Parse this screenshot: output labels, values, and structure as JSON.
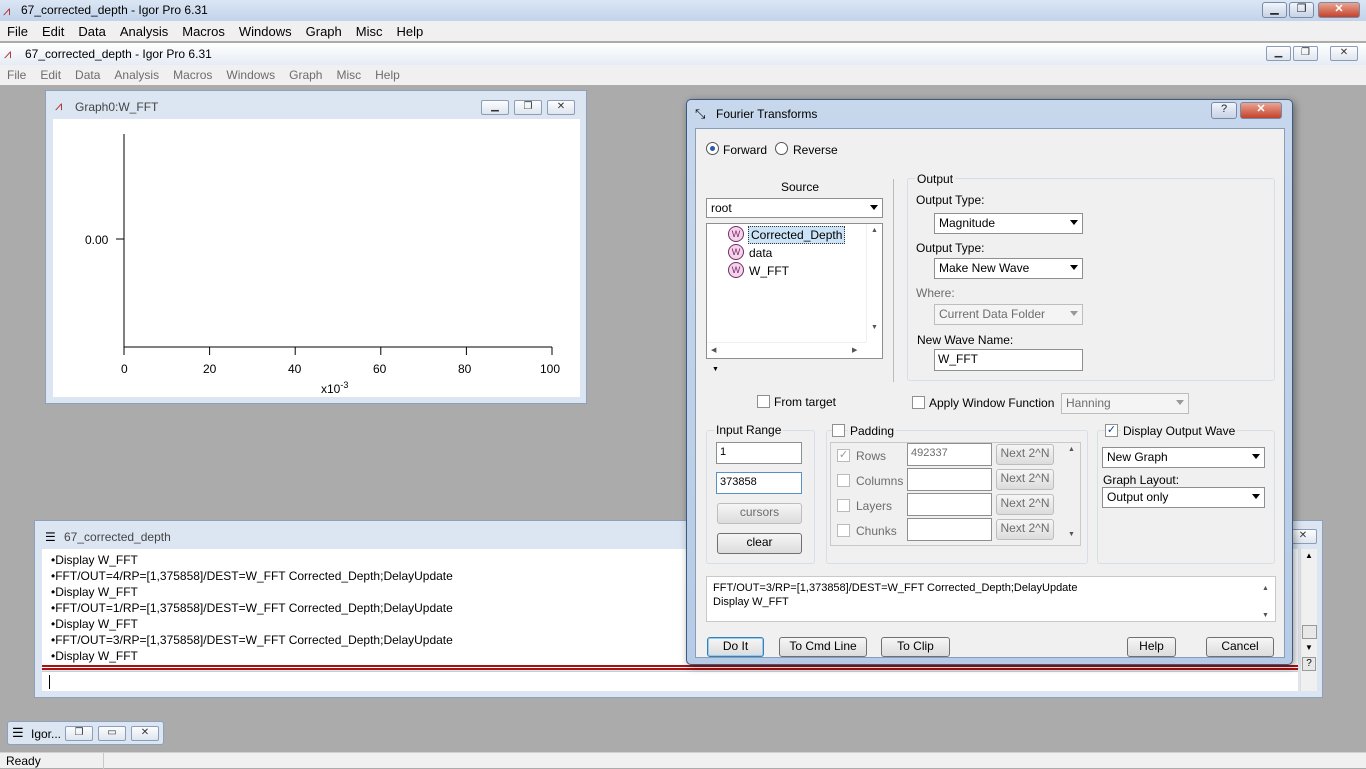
{
  "window_title": "67_corrected_depth - Igor Pro 6.31",
  "menu": [
    "File",
    "Edit",
    "Data",
    "Analysis",
    "Macros",
    "Windows",
    "Graph",
    "Misc",
    "Help"
  ],
  "inner_title": "67_corrected_depth - Igor Pro 6.31",
  "graph": {
    "title": "Graph0:W_FFT",
    "y_tick": "0.00",
    "x_ticks": [
      "0",
      "20",
      "40",
      "60",
      "80",
      "100"
    ],
    "x_multiplier": "x10",
    "x_exponent": "-3"
  },
  "history": {
    "title": "67_corrected_depth",
    "lines": [
      "•Display W_FFT",
      "•FFT/OUT=4/RP=[1,375858]/DEST=W_FFT Corrected_Depth;DelayUpdate",
      "•Display W_FFT",
      "•FFT/OUT=1/RP=[1,375858]/DEST=W_FFT Corrected_Depth;DelayUpdate",
      "•Display W_FFT",
      "•FFT/OUT=3/RP=[1,375858]/DEST=W_FFT Corrected_Depth;DelayUpdate",
      "•Display W_FFT"
    ]
  },
  "taskbar": {
    "minimized_label": "Igor..."
  },
  "status": "Ready",
  "dialog": {
    "title": "Fourier Transforms",
    "forward": "Forward",
    "reverse": "Reverse",
    "source_label": "Source",
    "source_folder": "root",
    "waves": [
      "Corrected_Depth",
      "data",
      "W_FFT"
    ],
    "output_group": "Output",
    "output_type_label_1": "Output Type:",
    "output_type_1": "Magnitude",
    "output_type_label_2": "Output Type:",
    "output_type_2": "Make New Wave",
    "where_label": "Where:",
    "where_value": "Current Data Folder",
    "new_wave_label": "New Wave Name:",
    "new_wave_value": "W_FFT",
    "from_target": "From target",
    "apply_window": "Apply Window Function",
    "window_fn": "Hanning",
    "input_range_label": "Input Range",
    "range_start": "1",
    "range_end": "373858",
    "cursors": "cursors",
    "clear": "clear",
    "padding_label": "Padding",
    "padding_rows": [
      {
        "label": "Rows",
        "value": "492337",
        "next": "Next 2^N"
      },
      {
        "label": "Columns",
        "value": "",
        "next": "Next 2^N"
      },
      {
        "label": "Layers",
        "value": "",
        "next": "Next 2^N"
      },
      {
        "label": "Chunks",
        "value": "",
        "next": "Next 2^N"
      }
    ],
    "display_output": "Display Output Wave",
    "display_target": "New Graph",
    "graph_layout_label": "Graph Layout:",
    "graph_layout": "Output only",
    "command_line_1": "FFT/OUT=3/RP=[1,373858]/DEST=W_FFT Corrected_Depth;DelayUpdate",
    "command_line_2": "Display W_FFT",
    "do_it": "Do It",
    "to_cmd": "To Cmd Line",
    "to_clip": "To Clip",
    "help": "Help",
    "cancel": "Cancel"
  }
}
